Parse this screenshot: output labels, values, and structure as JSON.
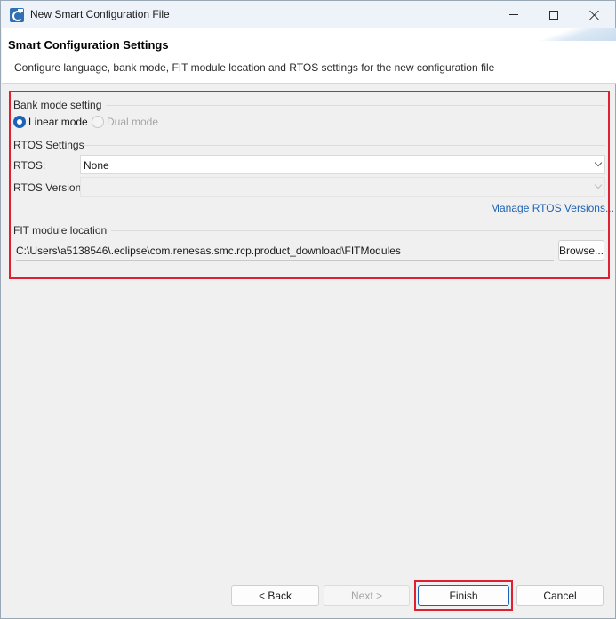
{
  "window": {
    "title": "New Smart Configuration File",
    "app_icon": "renesas-smc-icon",
    "controls": {
      "minimize": "minimize-icon",
      "maximize": "maximize-icon",
      "close": "close-icon"
    }
  },
  "header": {
    "title": "Smart Configuration Settings",
    "description": "Configure language, bank mode, FIT module location and RTOS settings for the new configuration file"
  },
  "bank_mode": {
    "group_label": "Bank mode setting",
    "options": [
      {
        "label": "Linear mode",
        "selected": true,
        "enabled": true
      },
      {
        "label": "Dual mode",
        "selected": false,
        "enabled": false
      }
    ]
  },
  "rtos": {
    "group_label": "RTOS Settings",
    "rtos_label": "RTOS:",
    "rtos_value": "None",
    "version_label": "RTOS Version:",
    "version_value": "",
    "manage_link": "Manage RTOS Versions..."
  },
  "fit": {
    "group_label": "FIT module location",
    "path": "C:\\Users\\a5138546\\.eclipse\\com.renesas.smc.rcp.product_download\\FITModules",
    "browse_label": "Browse..."
  },
  "footer": {
    "back_label": "< Back",
    "next_label": "Next >",
    "finish_label": "Finish",
    "cancel_label": "Cancel"
  },
  "colors": {
    "highlight": "#e02030",
    "accent": "#1a63b8",
    "link": "#1d63b3"
  }
}
